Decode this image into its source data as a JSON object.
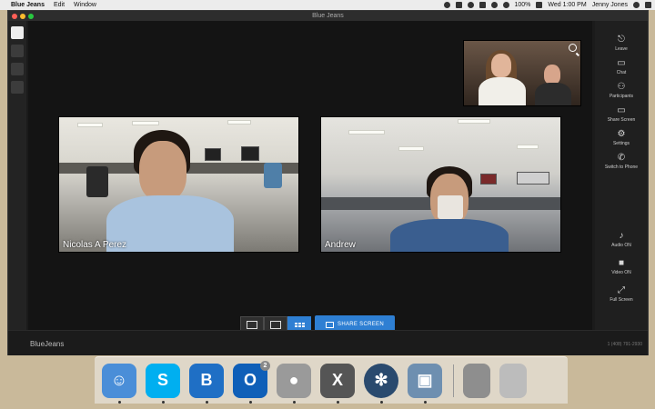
{
  "menubar": {
    "app_name": "Blue Jeans",
    "menus": [
      "Edit",
      "Window"
    ],
    "battery": "100%",
    "clock": "Wed 1:00 PM",
    "user": "Jenny Jones"
  },
  "window": {
    "title": "Blue Jeans"
  },
  "participants": [
    {
      "name": "Nicolas A Perez"
    },
    {
      "name": "Andrew"
    }
  ],
  "controls": {
    "share_screen": "SHARE SCREEN"
  },
  "right_panel": {
    "items": [
      {
        "label": "Leave",
        "icon": "leave-icon"
      },
      {
        "label": "Chat",
        "icon": "chat-icon"
      },
      {
        "label": "Participants",
        "icon": "participants-icon"
      },
      {
        "label": "Share Screen",
        "icon": "monitor-icon"
      },
      {
        "label": "Settings",
        "icon": "gear-icon"
      },
      {
        "label": "Switch to Phone",
        "icon": "phone-icon"
      },
      {
        "label": "Audio ON",
        "icon": "microphone-icon"
      },
      {
        "label": "Video ON",
        "icon": "camera-icon"
      },
      {
        "label": "Full Screen",
        "icon": "fullscreen-icon"
      }
    ]
  },
  "footer": {
    "brand": "BlueJeans",
    "phone": "1 (408) 791-2930"
  },
  "dock": {
    "apps": [
      {
        "name": "finder",
        "color": "#4a8ed8",
        "glyph": "☺"
      },
      {
        "name": "skype",
        "color": "#00aff0",
        "glyph": "S"
      },
      {
        "name": "bluejeans",
        "color": "#1f6fc5",
        "glyph": "B"
      },
      {
        "name": "outlook",
        "color": "#0f5fb8",
        "glyph": "O",
        "badge": "2"
      },
      {
        "name": "chrome",
        "color": "#9a9a9a",
        "glyph": "●"
      },
      {
        "name": "excel",
        "color": "#555555",
        "glyph": "X"
      },
      {
        "name": "sourcetree",
        "color": "#2a4a6e",
        "glyph": "✻"
      },
      {
        "name": "preview",
        "color": "#6e8fb0",
        "glyph": "▣"
      }
    ],
    "extras": [
      {
        "name": "document-stack",
        "color": "#8e8e8e"
      },
      {
        "name": "trash",
        "color": "#bcbcbc"
      }
    ]
  }
}
